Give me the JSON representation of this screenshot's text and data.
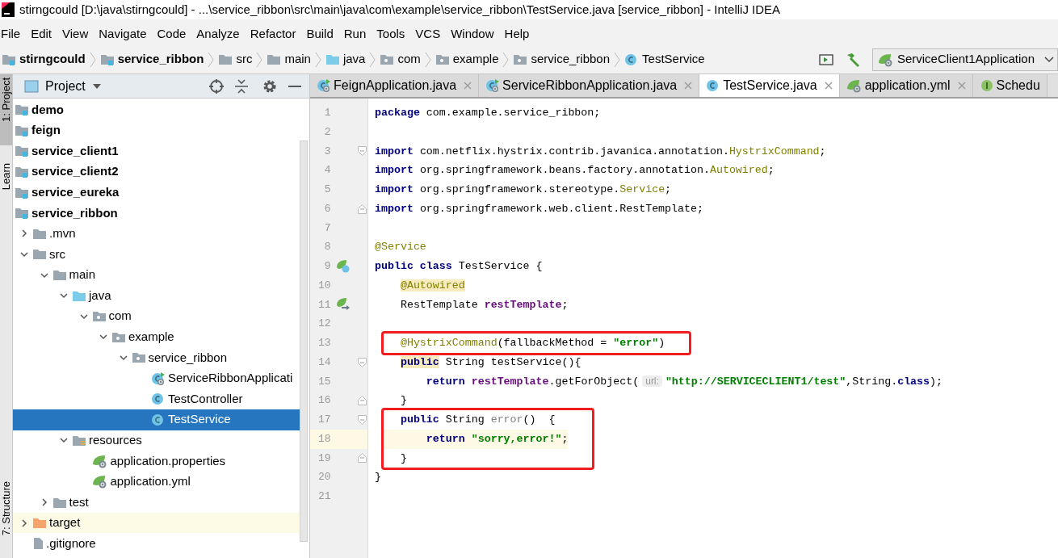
{
  "window": {
    "title": "stirngcould [D:\\java\\stirngcould] - ...\\service_ribbon\\src\\main\\java\\com\\example\\service_ribbon\\TestService.java [service_ribbon] - IntelliJ IDEA"
  },
  "menu": [
    "File",
    "Edit",
    "View",
    "Navigate",
    "Code",
    "Analyze",
    "Refactor",
    "Build",
    "Run",
    "Tools",
    "VCS",
    "Window",
    "Help"
  ],
  "breadcrumbs": [
    {
      "label": "stirngcould",
      "kind": "module"
    },
    {
      "label": "service_ribbon",
      "kind": "module"
    },
    {
      "label": "src",
      "kind": "folder"
    },
    {
      "label": "main",
      "kind": "folder"
    },
    {
      "label": "java",
      "kind": "source"
    },
    {
      "label": "com",
      "kind": "package"
    },
    {
      "label": "example",
      "kind": "package"
    },
    {
      "label": "service_ribbon",
      "kind": "package"
    },
    {
      "label": "TestService",
      "kind": "class"
    }
  ],
  "run_configuration": "ServiceClient1Application",
  "tool_strip": [
    "1: Project",
    "Learn",
    "7: Structure"
  ],
  "project_panel": {
    "title": "Project",
    "tree": [
      {
        "name": "demo",
        "kind": "module",
        "selected": false
      },
      {
        "name": "feign",
        "kind": "module",
        "selected": false
      },
      {
        "name": "service_client1",
        "kind": "module",
        "selected": false
      },
      {
        "name": "service_client2",
        "kind": "module",
        "selected": false
      },
      {
        "name": "service_eureka",
        "kind": "module",
        "selected": false
      },
      {
        "name": "service_ribbon",
        "kind": "module",
        "selected": false,
        "children": [
          {
            "name": ".mvn",
            "kind": "folder",
            "expanded": false,
            "selected": false
          },
          {
            "name": "src",
            "kind": "folder",
            "expanded": true,
            "selected": false,
            "children": [
              {
                "name": "main",
                "kind": "folder",
                "expanded": true,
                "selected": false,
                "children": [
                  {
                    "name": "java",
                    "kind": "source",
                    "expanded": true,
                    "selected": false,
                    "children": [
                      {
                        "name": "com",
                        "kind": "package",
                        "expanded": true,
                        "selected": false,
                        "children": [
                          {
                            "name": "example",
                            "kind": "package",
                            "expanded": true,
                            "selected": false,
                            "children": [
                              {
                                "name": "service_ribbon",
                                "kind": "package",
                                "expanded": true,
                                "selected": false,
                                "children": [
                                  {
                                    "name": "ServiceRibbonApplicati",
                                    "kind": "spring_class",
                                    "selected": false
                                  },
                                  {
                                    "name": "TestController",
                                    "kind": "class",
                                    "selected": false
                                  },
                                  {
                                    "name": "TestService",
                                    "kind": "class",
                                    "selected": true
                                  }
                                ]
                              }
                            ]
                          }
                        ]
                      }
                    ]
                  },
                  {
                    "name": "resources",
                    "kind": "resources",
                    "expanded": true,
                    "selected": false,
                    "children": [
                      {
                        "name": "application.properties",
                        "kind": "spring_file",
                        "selected": false
                      },
                      {
                        "name": "application.yml",
                        "kind": "spring_file",
                        "selected": false
                      }
                    ]
                  }
                ]
              },
              {
                "name": "test",
                "kind": "folder",
                "expanded": false,
                "selected": false
              }
            ]
          },
          {
            "name": "target",
            "kind": "excluded",
            "expanded": false,
            "selected": false
          },
          {
            "name": ".gitignore",
            "kind": "file",
            "selected": false
          }
        ]
      }
    ]
  },
  "editor": {
    "tabs": [
      {
        "label": "FeignApplication.java",
        "kind": "spring_class",
        "selected": false
      },
      {
        "label": "ServiceRibbonApplication.java",
        "kind": "spring_class",
        "selected": false
      },
      {
        "label": "TestService.java",
        "kind": "class",
        "selected": true
      },
      {
        "label": "application.yml",
        "kind": "spring_file",
        "selected": false
      },
      {
        "label": "Schedu",
        "kind": "interface",
        "selected": false
      }
    ],
    "groups": [
      {
        "boxed": false,
        "lines": [
          {
            "number": "1",
            "tokens": [
              {
                "kind": "keyword",
                "text": "package"
              },
              {
                "kind": "plain",
                "text": " com.example.service_ribbon;"
              }
            ]
          },
          {
            "number": "2"
          },
          {
            "number": "3",
            "fold": {
              "kind": "start"
            },
            "tokens": [
              {
                "kind": "keyword",
                "text": "import"
              },
              {
                "kind": "plain",
                "text": " com.netflix.hystrix.contrib.javanica.annotation."
              },
              {
                "kind": "annotation",
                "text": "HystrixCommand"
              },
              {
                "kind": "plain",
                "text": ";"
              }
            ]
          },
          {
            "number": "4",
            "tokens": [
              {
                "kind": "keyword",
                "text": "import"
              },
              {
                "kind": "plain",
                "text": " org.springframework.beans.factory.annotation."
              },
              {
                "kind": "annotation",
                "text": "Autowired"
              },
              {
                "kind": "plain",
                "text": ";"
              }
            ]
          },
          {
            "number": "5",
            "tokens": [
              {
                "kind": "keyword",
                "text": "import"
              },
              {
                "kind": "plain",
                "text": " org.springframework.stereotype."
              },
              {
                "kind": "annotation",
                "text": "Service"
              },
              {
                "kind": "plain",
                "text": ";"
              }
            ]
          },
          {
            "number": "6",
            "fold": {
              "kind": "end"
            },
            "tokens": [
              {
                "kind": "keyword",
                "text": "import"
              },
              {
                "kind": "plain",
                "text": " org.springframework.web.client.RestTemplate;"
              }
            ]
          },
          {
            "number": "7"
          },
          {
            "number": "8",
            "tokens": [
              {
                "kind": "annotation",
                "text": "@Service"
              }
            ]
          },
          {
            "number": "9",
            "gutter_marker": {
              "kind": "bean"
            },
            "tokens": [
              {
                "kind": "keyword",
                "text": "public class"
              },
              {
                "kind": "plain",
                "text": " TestService {"
              }
            ]
          },
          {
            "number": "10",
            "tokens": [
              {
                "kind": "annotation",
                "text": "    @Autowired",
                "marked": true
              }
            ]
          },
          {
            "number": "11",
            "gutter_marker": {
              "kind": "autowired"
            },
            "tokens": [
              {
                "kind": "plain",
                "text": "    RestTemplate "
              },
              {
                "kind": "field",
                "text": "restTemplate"
              },
              {
                "kind": "plain",
                "text": ";"
              }
            ]
          },
          {
            "number": "12"
          }
        ]
      },
      {
        "boxed": true,
        "lines": [
          {
            "number": "13",
            "tokens": [
              {
                "kind": "annotation",
                "text": "    @HystrixCommand"
              },
              {
                "kind": "plain",
                "text": "(fallbackMethod = "
              },
              {
                "kind": "string",
                "text": "\"error\""
              },
              {
                "kind": "plain",
                "text": ")"
              }
            ]
          }
        ]
      },
      {
        "boxed": false,
        "lines": [
          {
            "number": "14",
            "fold": {
              "kind": "start"
            },
            "tokens": [
              {
                "kind": "keyword",
                "text": "    public",
                "marked": true
              },
              {
                "kind": "plain",
                "text": " String testService(){"
              }
            ]
          },
          {
            "number": "15",
            "tokens": [
              {
                "kind": "keyword",
                "text": "        return"
              },
              {
                "kind": "field",
                "text": " restTemplate"
              },
              {
                "kind": "plain",
                "text": ".getForObject("
              },
              {
                "kind": "hint",
                "text": "url:"
              },
              {
                "kind": "string",
                "text": "\"http://SERVICECLIENT1/test\""
              },
              {
                "kind": "plain",
                "text": ",String."
              },
              {
                "kind": "keyword",
                "text": "class"
              },
              {
                "kind": "plain",
                "text": ");"
              }
            ]
          },
          {
            "number": "16",
            "fold": {
              "kind": "end"
            },
            "tokens": [
              {
                "kind": "plain",
                "text": "    }"
              }
            ]
          }
        ]
      },
      {
        "boxed": true,
        "lines": [
          {
            "number": "17",
            "fold": {
              "kind": "start"
            },
            "tokens": [
              {
                "kind": "keyword",
                "text": "    public"
              },
              {
                "kind": "plain",
                "text": " String "
              },
              {
                "kind": "unused",
                "text": "error"
              },
              {
                "kind": "plain",
                "text": "()  {"
              }
            ]
          },
          {
            "number": "18",
            "current": true,
            "tokens": [
              {
                "kind": "keyword",
                "text": "        return"
              },
              {
                "kind": "string",
                "text": " \"sorry,error!\""
              },
              {
                "kind": "plain",
                "text": ";"
              }
            ]
          },
          {
            "number": "19",
            "fold": {
              "kind": "end"
            },
            "tokens": [
              {
                "kind": "plain",
                "text": "    }"
              }
            ]
          }
        ]
      },
      {
        "boxed": false,
        "lines": [
          {
            "number": "20",
            "tokens": [
              {
                "kind": "plain",
                "text": "}"
              }
            ]
          },
          {
            "number": "21"
          }
        ]
      }
    ]
  }
}
